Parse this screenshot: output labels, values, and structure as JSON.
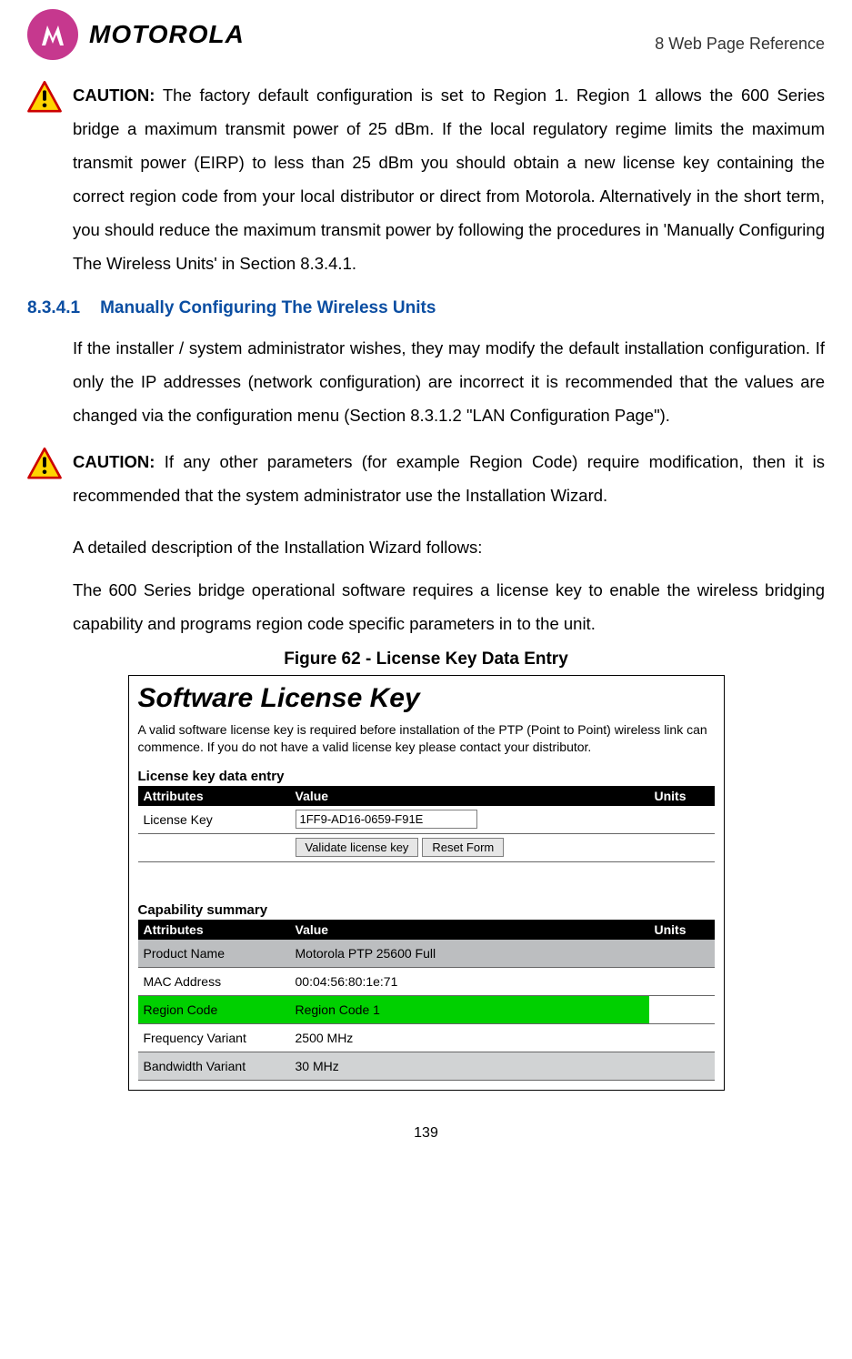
{
  "header": {
    "logo_text": "MOTOROLA",
    "chapter_ref": "8 Web Page Reference"
  },
  "caution1": {
    "label": "CAUTION:",
    "text": " The factory default configuration is set to Region 1. Region 1 allows the 600 Series bridge a maximum transmit power of 25 dBm. If the local regulatory regime limits the maximum transmit power (EIRP) to less than 25 dBm you should obtain a new license key containing the correct region code from your local distributor or direct from Motorola. Alternatively in the short term, you should reduce the maximum transmit power by following the procedures in  'Manually Configuring The Wireless Units' in Section 8.3.4.1."
  },
  "section": {
    "number": "8.3.4.1",
    "title": "Manually Configuring The Wireless Units"
  },
  "para1": "If the installer / system administrator wishes, they may modify the default installation configuration. If only the IP addresses (network configuration) are incorrect it is recommended that the values are changed via the configuration menu (Section 8.3.1.2 \"LAN Configuration Page\").",
  "caution2": {
    "label": "CAUTION:",
    "text": " If any other parameters (for example Region Code) require modification, then it is recommended that the system administrator use the Installation Wizard."
  },
  "para2": "A detailed description of the Installation Wizard follows:",
  "para3": "The 600 Series bridge operational software requires a license key to enable the wireless bridging capability and programs region code specific parameters in to the unit.",
  "figure": {
    "caption": "Figure 62 - License Key Data Entry",
    "title": "Software License Key",
    "description": "A valid software license key is required before installation of the PTP (Point to Point) wireless link can commence. If you do not have a valid license key please contact your distributor.",
    "entry_label": "License key data entry",
    "headers": {
      "attr": "Attributes",
      "value": "Value",
      "units": "Units"
    },
    "entry_rows": [
      {
        "attr": "License Key",
        "value": "1FF9-AD16-0659-F91E",
        "units": ""
      }
    ],
    "buttons": {
      "validate": "Validate license key",
      "reset": "Reset Form"
    },
    "capability_label": "Capability summary",
    "capability_rows": [
      {
        "attr": "Product Name",
        "value": "Motorola PTP 25600 Full",
        "units": "",
        "highlight": "gray"
      },
      {
        "attr": "MAC Address",
        "value": "00:04:56:80:1e:71",
        "units": "",
        "highlight": ""
      },
      {
        "attr": "Region Code",
        "value": "Region Code 1",
        "units": "",
        "highlight": "green"
      },
      {
        "attr": "Frequency Variant",
        "value": "2500 MHz",
        "units": "",
        "highlight": ""
      },
      {
        "attr": "Bandwidth Variant",
        "value": "30 MHz",
        "units": "",
        "highlight": "gray2"
      }
    ]
  },
  "page_number": "139"
}
